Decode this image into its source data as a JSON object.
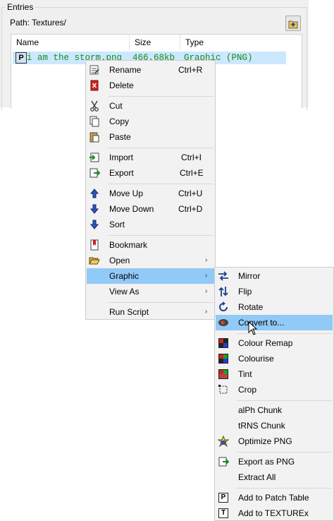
{
  "entries": {
    "group_title": "Entries",
    "path_label": "Path: Textures/",
    "columns": [
      "Name",
      "Size",
      "Type"
    ],
    "selected_row": {
      "name": "i am the storm.png",
      "size": "466.68kb",
      "type": "Graphic (PNG)"
    }
  },
  "context_menu": {
    "rename": {
      "label": "Rename",
      "shortcut": "Ctrl+R"
    },
    "delete": {
      "label": "Delete"
    },
    "cut": {
      "label": "Cut"
    },
    "copy": {
      "label": "Copy"
    },
    "paste": {
      "label": "Paste"
    },
    "import": {
      "label": "Import",
      "shortcut": "Ctrl+I"
    },
    "export": {
      "label": "Export",
      "shortcut": "Ctrl+E"
    },
    "move_up": {
      "label": "Move Up",
      "shortcut": "Ctrl+U"
    },
    "move_down": {
      "label": "Move Down",
      "shortcut": "Ctrl+D"
    },
    "sort": {
      "label": "Sort"
    },
    "bookmark": {
      "label": "Bookmark"
    },
    "open": {
      "label": "Open"
    },
    "graphic": {
      "label": "Graphic"
    },
    "view_as": {
      "label": "View As"
    },
    "run_script": {
      "label": "Run Script"
    },
    "submenu_arrow": "›"
  },
  "graphic_submenu": {
    "mirror": "Mirror",
    "flip": "Flip",
    "rotate": "Rotate",
    "convert_to": "Convert to...",
    "colour_remap": "Colour Remap",
    "colourise": "Colourise",
    "tint": "Tint",
    "crop": "Crop",
    "alph_chunk": "alPh Chunk",
    "trns_chunk": "tRNS Chunk",
    "optimize_png": "Optimize PNG",
    "export_as_png": "Export as PNG",
    "extract_all": "Extract All",
    "add_to_patch_table": "Add to Patch Table",
    "add_to_texturex": "Add to TEXTUREx"
  },
  "colors": {
    "highlight": "#91c9f7",
    "row_selected": "#cce8ff",
    "entry_text": "#1a8a1a",
    "menu_bg": "#f2f2f2"
  }
}
